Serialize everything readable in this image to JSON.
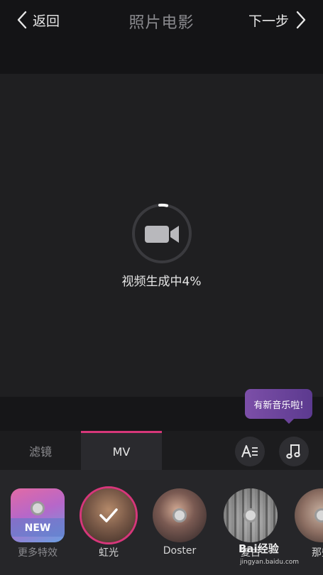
{
  "header": {
    "back_label": "返回",
    "title": "照片电影",
    "next_label": "下一步"
  },
  "preview": {
    "progress_text": "视频生成中4%",
    "progress_percent": 4
  },
  "tooltip": {
    "text": "有新音乐啦!"
  },
  "tabs": [
    {
      "label": "滤镜",
      "active": false
    },
    {
      "label": "MV",
      "active": true
    }
  ],
  "tools": {
    "text_icon": "text-style-icon",
    "music_icon": "music-note-icon"
  },
  "effects": [
    {
      "label": "更多特效",
      "badge": "NEW",
      "selected": false
    },
    {
      "label": "虹光",
      "selected": true
    },
    {
      "label": "Doster",
      "selected": false
    },
    {
      "label": "复古",
      "selected": false
    },
    {
      "label": "那些",
      "selected": false
    }
  ],
  "watermark": {
    "brand": "Bai经验",
    "url": "jingyan.baidu.com"
  },
  "colors": {
    "accent": "#d6377a",
    "tooltip": "#6a4399"
  }
}
